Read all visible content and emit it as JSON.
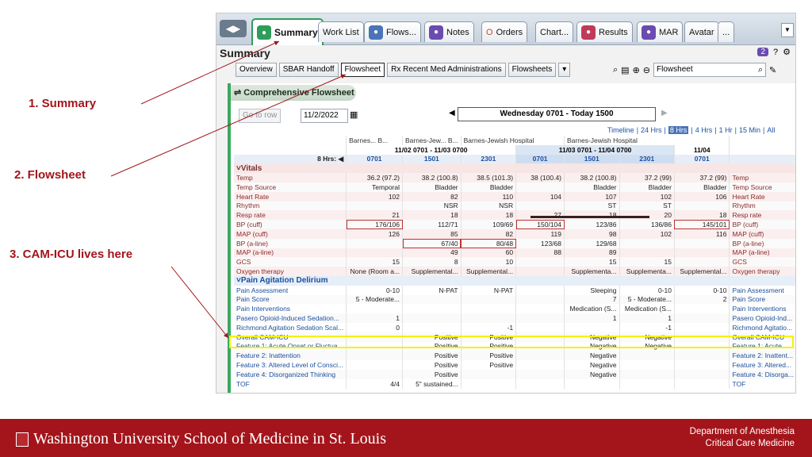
{
  "callouts": {
    "c1": "1.   Summary",
    "c2": "2. Flowsheet",
    "c3": "3. CAM-ICU lives here"
  },
  "toolbar": {
    "tabs": [
      {
        "label": "Summary",
        "icon": "summary-icon",
        "color": "#2f9c5b"
      },
      {
        "label": "Work List"
      },
      {
        "label": "Flows...",
        "icon": "flows-icon",
        "color": "#4a74b8"
      },
      {
        "label": "Notes",
        "icon": "notes-icon",
        "color": "#6b4bb0"
      },
      {
        "label": "Orders",
        "icon_text": "O"
      },
      {
        "label": "Chart..."
      },
      {
        "label": "Results",
        "icon": "flask-icon",
        "color": "#c03a5a"
      },
      {
        "label": "MAR",
        "icon": "mar-icon",
        "color": "#6b4bb0"
      },
      {
        "label": "Avatar"
      },
      {
        "label": "..."
      }
    ]
  },
  "summary_title": "Summary",
  "badge_count": "2",
  "subtabs": [
    "Overview",
    "SBAR Handoff",
    "Flowsheet",
    "Rx Recent Med Administrations",
    "Flowsheets"
  ],
  "search": {
    "value": "Flowsheet"
  },
  "panel": {
    "title": "Comprehensive Flowsheet",
    "goto_label": "Go to row",
    "date": "11/2/2022",
    "range": "Wednesday 0701 - Today 1500",
    "timeline": [
      "Timeline",
      "24 Hrs",
      "8 Hrs",
      "4 Hrs",
      "1 Hr",
      "15 Min",
      "All"
    ]
  },
  "grid": {
    "hosp_row": [
      "Barnes...",
      "B...",
      "Barnes-Jew...",
      "B...",
      "Barnes-Jewish Hospital",
      "Barnes-Jewish Hospital"
    ],
    "date_row": [
      "11/02 0701 - 11/03 0700",
      "11/03 0701 - 11/04 0700",
      "11/04"
    ],
    "hrs_label": "8 Hrs:",
    "times": [
      "0701",
      "1501",
      "2301",
      "0701",
      "1501",
      "2301",
      "0701"
    ],
    "sections": [
      {
        "title": "Vitals",
        "style": "vit",
        "rows": [
          {
            "label": "Temp",
            "vals": [
              "36.2 (97.2)",
              "38.2 (100.8)",
              "38.5 (101.3)",
              "38 (100.4)",
              "38.2 (100.8)",
              "37.2 (99)",
              "37.2 (99)"
            ],
            "right": "Temp"
          },
          {
            "label": "Temp Source",
            "vals": [
              "Temporal",
              "Bladder",
              "Bladder",
              "",
              "Bladder",
              "Bladder",
              "Bladder"
            ],
            "right": "Temp Source"
          },
          {
            "label": "Heart Rate",
            "vals": [
              "102",
              "82",
              "110",
              "104",
              "107",
              "102",
              "106"
            ],
            "right": "Heart Rate"
          },
          {
            "label": "Rhythm",
            "vals": [
              "",
              "NSR",
              "NSR",
              "",
              "ST",
              "ST",
              ""
            ],
            "right": "Rhythm"
          },
          {
            "label": "Resp rate",
            "vals": [
              "21",
              "18",
              "18",
              "27",
              "18",
              "20",
              "18"
            ],
            "right": "Resp rate"
          },
          {
            "label": "BP (cuff)",
            "vals": [
              "176/106",
              "112/71",
              "109/69",
              "150/104",
              "123/86",
              "136/86",
              "145/101"
            ],
            "right": "BP (cuff)",
            "boxed": [
              0,
              3,
              6
            ]
          },
          {
            "label": "MAP (cuff)",
            "vals": [
              "126",
              "85",
              "82",
              "119",
              "98",
              "102",
              "116"
            ],
            "right": "MAP (cuff)"
          },
          {
            "label": "BP (a-line)",
            "vals": [
              "",
              "67/40",
              "80/48",
              "123/68",
              "129/68",
              "",
              ""
            ],
            "right": "BP (a-line)",
            "boxed": [
              1,
              2
            ]
          },
          {
            "label": "MAP (a-line)",
            "vals": [
              "",
              "49",
              "60",
              "88",
              "89",
              "",
              ""
            ],
            "right": "MAP (a-line)"
          },
          {
            "label": "GCS",
            "vals": [
              "15",
              "8",
              "10",
              "",
              "15",
              "15",
              ""
            ],
            "right": "GCS"
          },
          {
            "label": "Oxygen therapy",
            "vals": [
              "None (Room a...",
              "Supplemental...",
              "Supplemental...",
              "",
              "Supplementa...",
              "Supplementa...",
              "Supplemental..."
            ],
            "right": "Oxygen therapy"
          }
        ]
      },
      {
        "title": "Pain Agitation Delirium",
        "style": "pad",
        "rows": [
          {
            "label": "Pain Assessment",
            "vals": [
              "0-10",
              "N-PAT",
              "N-PAT",
              "",
              "Sleeping",
              "0-10",
              "0-10"
            ],
            "right": "Pain Assessment"
          },
          {
            "label": "Pain Score",
            "vals": [
              "5 - Moderate...",
              "",
              "",
              "",
              "7",
              "5 - Moderate...",
              "2"
            ],
            "right": "Pain Score"
          },
          {
            "label": "Pain Interventions",
            "vals": [
              "",
              "",
              "",
              "",
              "Medication (S...",
              "Medication (S...",
              ""
            ],
            "right": "Pain Interventions"
          },
          {
            "label": "Pasero Opioid-Induced Sedation...",
            "vals": [
              "1",
              "",
              "",
              "",
              "1",
              "1",
              ""
            ],
            "right": "Pasero Opioid-Ind..."
          },
          {
            "label": "Richmond Agitation Sedation Scal...",
            "vals": [
              "0",
              "",
              "-1",
              "",
              "",
              "-1",
              ""
            ],
            "right": "Richmond Agitatio..."
          },
          {
            "label": "Overall CAM-ICU",
            "vals": [
              "",
              "Positive",
              "Positive",
              "",
              "Negative",
              "Negative",
              ""
            ],
            "right": "Overall CAM-ICU",
            "hl": true
          },
          {
            "label": "Feature 1: Acute Onset or Fluctua...",
            "vals": [
              "",
              "Positive",
              "Positive",
              "",
              "Negative",
              "Negative",
              ""
            ],
            "right": "Feature 1: Acute..."
          },
          {
            "label": "Feature 2: Inattention",
            "vals": [
              "",
              "Positive",
              "Positive",
              "",
              "Negative",
              "",
              ""
            ],
            "right": "Feature 2: Inattent..."
          },
          {
            "label": "Feature 3: Altered Level of Consci...",
            "vals": [
              "",
              "Positive",
              "Positive",
              "",
              "Negative",
              "",
              ""
            ],
            "right": "Feature 3: Altered..."
          },
          {
            "label": "Feature 4: Disorganized Thinking",
            "vals": [
              "",
              "Positive",
              "",
              "",
              "Negative",
              "",
              ""
            ],
            "right": "Feature 4: Disorga..."
          },
          {
            "label": "TOF",
            "vals": [
              "4/4",
              "5\" sustained...",
              "",
              "",
              "",
              "",
              ""
            ],
            "right": "TOF"
          }
        ]
      }
    ]
  },
  "footer": {
    "university": "Washington University School of Medicine in St. Louis",
    "dept_line1": "Department of Anesthesia",
    "dept_line2": "Critical Care Medicine"
  }
}
